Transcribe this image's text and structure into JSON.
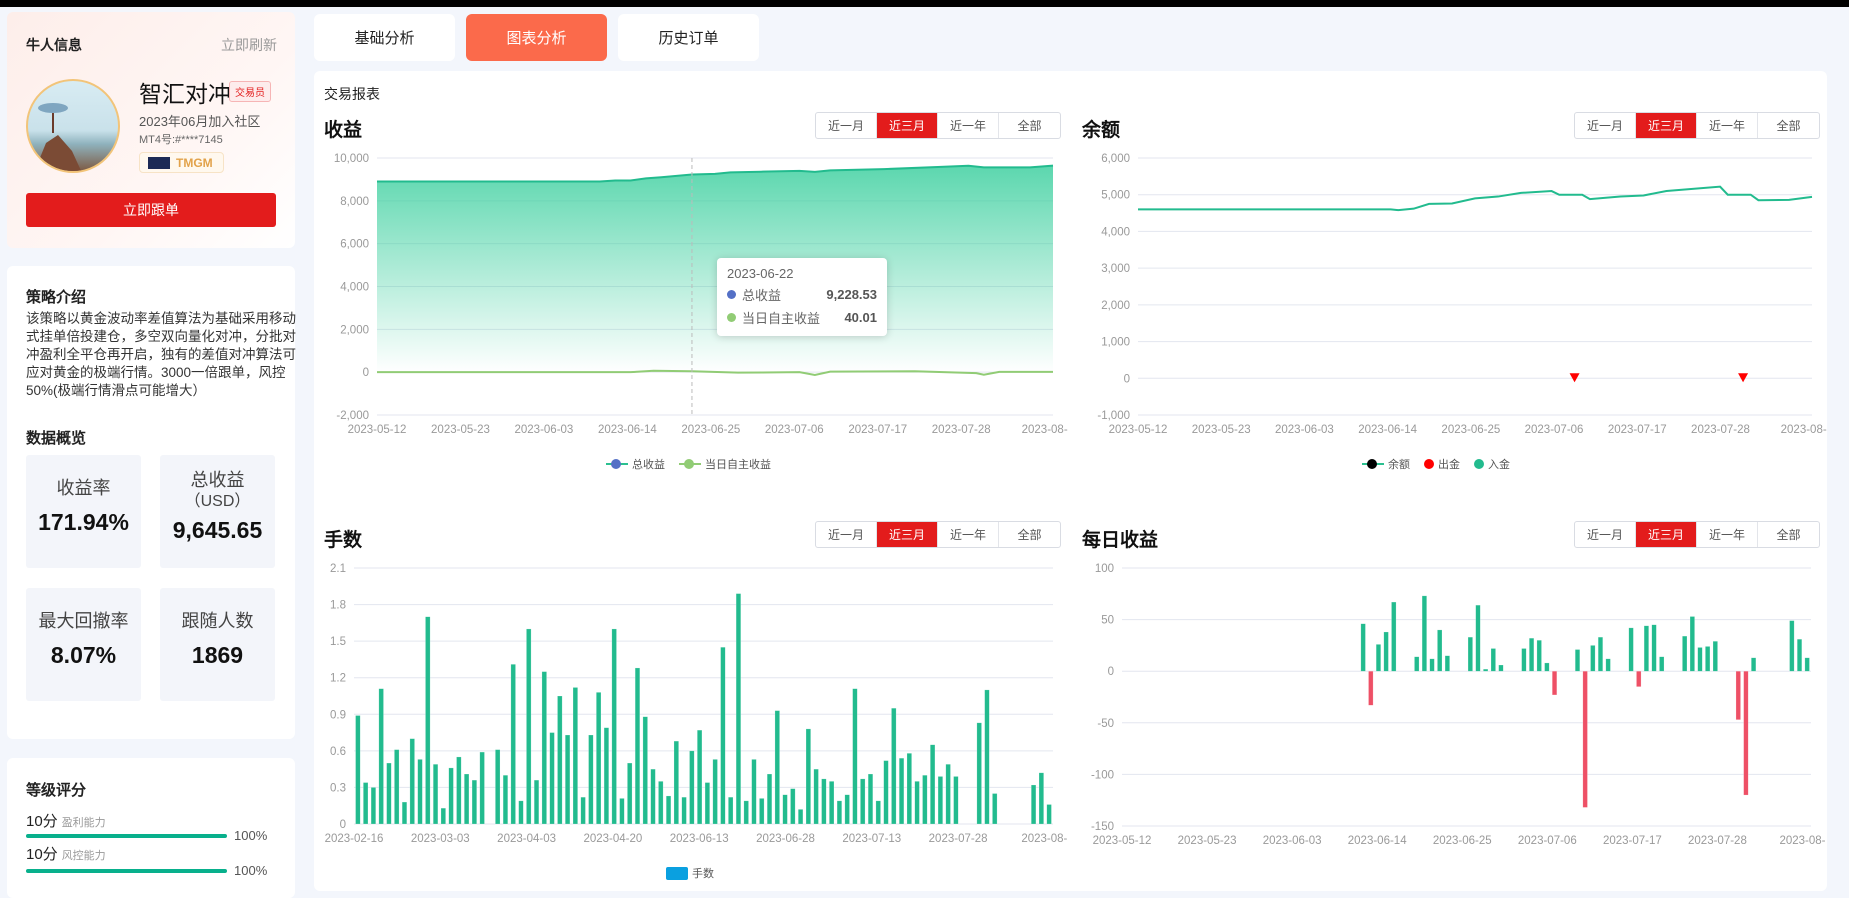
{
  "profile": {
    "section_title": "牛人信息",
    "refresh_label": "立即刷新",
    "name": "智汇对冲",
    "role_badge": "交易员",
    "joined": "2023年06月加入社区",
    "mt4": "MT4号:#****7145",
    "broker": "TMGM",
    "follow_button": "立即跟单"
  },
  "strategy": {
    "title": "策略介绍",
    "description": "该策略以黄金波动率差值算法为基础采用移动式挂单倍投建仓，多空双向量化对冲，分批对冲盈利全平仓再开启，独有的差值对冲算法可应对黄金的极端行情。3000一倍跟单，风控50%(极端行情滑点可能增大）"
  },
  "overview": {
    "title": "数据概览",
    "stats": [
      {
        "label": "收益率",
        "value": "171.94%"
      },
      {
        "label": "总收益",
        "label2": "（USD）",
        "value": "9,645.65"
      },
      {
        "label": "最大回撤率",
        "value": "8.07%"
      },
      {
        "label": "跟随人数",
        "value": "1869"
      }
    ]
  },
  "rating": {
    "title": "等级评分",
    "items": [
      {
        "score": "10分",
        "name": "盈利能力",
        "percent": "100%",
        "fraction": 1.0
      },
      {
        "score": "10分",
        "name": "风控能力",
        "percent": "100%",
        "fraction": 1.0
      }
    ]
  },
  "tabs": [
    {
      "label": "基础分析",
      "active": false
    },
    {
      "label": "图表分析",
      "active": true
    },
    {
      "label": "历史订单",
      "active": false
    }
  ],
  "report_title": "交易报表",
  "range_options": [
    "近一月",
    "近三月",
    "近一年",
    "全部"
  ],
  "range_selected": 1,
  "colors": {
    "accent": "#e31c1c",
    "tab_active": "#fb6a4b",
    "green": "#22bb8e",
    "red": "#ee5066",
    "blue": "#5470c6",
    "lightgreen": "#91cc75"
  },
  "tooltip": {
    "date": "2023-06-22",
    "rows": [
      {
        "label": "总收益",
        "value": "9,228.53"
      },
      {
        "label": "当日自主收益",
        "value": "40.01"
      }
    ]
  },
  "chart_data": [
    {
      "id": "profit",
      "type": "line",
      "title": "收益",
      "ylim": [
        -2000,
        10000
      ],
      "yticks": [
        "-2,000",
        "0",
        "2,000",
        "4,000",
        "6,000",
        "8,000",
        "10,000"
      ],
      "ytick_values": [
        -2000,
        0,
        2000,
        4000,
        6000,
        8000,
        10000
      ],
      "x_range": [
        "2023-05-12",
        "2023-08-08"
      ],
      "xticks": [
        "2023-05-12",
        "2023-05-23",
        "2023-06-03",
        "2023-06-14",
        "2023-06-25",
        "2023-07-06",
        "2023-07-17",
        "2023-07-28",
        "2023-08-"
      ],
      "legend": [
        "总收益",
        "当日自主收益"
      ],
      "series": [
        {
          "name": "总收益",
          "points": [
            [
              "2023-05-12",
              8900
            ],
            [
              "2023-06-10",
              8900
            ],
            [
              "2023-06-12",
              8950
            ],
            [
              "2023-06-14",
              8950
            ],
            [
              "2023-06-16",
              9050
            ],
            [
              "2023-06-18",
              9100
            ],
            [
              "2023-06-22",
              9228.53
            ],
            [
              "2023-06-25",
              9260
            ],
            [
              "2023-06-27",
              9330
            ],
            [
              "2023-07-01",
              9360
            ],
            [
              "2023-07-06",
              9400
            ],
            [
              "2023-07-08",
              9350
            ],
            [
              "2023-07-10",
              9420
            ],
            [
              "2023-07-17",
              9480
            ],
            [
              "2023-07-24",
              9580
            ],
            [
              "2023-07-28",
              9640
            ],
            [
              "2023-07-30",
              9560
            ],
            [
              "2023-08-05",
              9560
            ],
            [
              "2023-08-08",
              9645.65
            ]
          ]
        },
        {
          "name": "当日自主收益",
          "points": [
            [
              "2023-05-12",
              0
            ],
            [
              "2023-06-14",
              0
            ],
            [
              "2023-06-17",
              67
            ],
            [
              "2023-06-22",
              40.01
            ],
            [
              "2023-06-28",
              -23
            ],
            [
              "2023-07-06",
              0
            ],
            [
              "2023-07-08",
              -132
            ],
            [
              "2023-07-10",
              25
            ],
            [
              "2023-07-21",
              44
            ],
            [
              "2023-07-29",
              -47
            ],
            [
              "2023-07-30",
              -120
            ],
            [
              "2023-08-01",
              13
            ],
            [
              "2023-08-08",
              13
            ]
          ]
        }
      ]
    },
    {
      "id": "balance",
      "type": "line",
      "title": "余额",
      "ylim": [
        -1000,
        6000
      ],
      "yticks": [
        "-1,000",
        "0",
        "1,000",
        "2,000",
        "3,000",
        "4,000",
        "5,000",
        "6,000"
      ],
      "ytick_values": [
        -1000,
        0,
        1000,
        2000,
        3000,
        4000,
        5000,
        6000
      ],
      "x_range": [
        "2023-05-12",
        "2023-08-08"
      ],
      "xticks": [
        "2023-05-12",
        "2023-05-23",
        "2023-06-03",
        "2023-06-14",
        "2023-06-25",
        "2023-07-06",
        "2023-07-17",
        "2023-07-28",
        "2023-08-"
      ],
      "legend": [
        "余额",
        "出金",
        "入金"
      ],
      "series": [
        {
          "name": "余额",
          "points": [
            [
              "2023-05-12",
              4600
            ],
            [
              "2023-06-14",
              4600
            ],
            [
              "2023-06-15",
              4580
            ],
            [
              "2023-06-17",
              4620
            ],
            [
              "2023-06-19",
              4750
            ],
            [
              "2023-06-22",
              4760
            ],
            [
              "2023-06-25",
              4900
            ],
            [
              "2023-06-28",
              4950
            ],
            [
              "2023-07-01",
              5050
            ],
            [
              "2023-07-05",
              5100
            ],
            [
              "2023-07-06",
              5000
            ],
            [
              "2023-07-09",
              5000
            ],
            [
              "2023-07-10",
              4880
            ],
            [
              "2023-07-14",
              4950
            ],
            [
              "2023-07-17",
              4980
            ],
            [
              "2023-07-20",
              5100
            ],
            [
              "2023-07-27",
              5220
            ],
            [
              "2023-07-28",
              5000
            ],
            [
              "2023-07-31",
              5000
            ],
            [
              "2023-08-01",
              4850
            ],
            [
              "2023-08-05",
              4860
            ],
            [
              "2023-08-08",
              4940
            ]
          ]
        },
        {
          "name": "出金",
          "points": [
            [
              "2023-07-08",
              0
            ],
            [
              "2023-07-30",
              0
            ]
          ]
        },
        {
          "name": "入金",
          "points": []
        }
      ]
    },
    {
      "id": "lots",
      "type": "bar",
      "title": "手数",
      "ylim": [
        0,
        2.1
      ],
      "yticks": [
        "0",
        "0.3",
        "0.6",
        "0.9",
        "1.2",
        "1.5",
        "1.8",
        "2.1"
      ],
      "ytick_values": [
        0,
        0.3,
        0.6,
        0.9,
        1.2,
        1.5,
        1.8,
        2.1
      ],
      "xticks": [
        "2023-02-16",
        "2023-03-03",
        "2023-04-03",
        "2023-04-20",
        "2023-06-13",
        "2023-06-28",
        "2023-07-13",
        "2023-07-28",
        "2023-08-"
      ],
      "legend": [
        "手数"
      ],
      "values": [
        0.89,
        0.34,
        0.3,
        1.11,
        0.5,
        0.61,
        0.18,
        0.7,
        0.53,
        1.7,
        0.49,
        0.13,
        0.46,
        0.55,
        0.41,
        0.36,
        0.59,
        null,
        0.61,
        0.4,
        1.31,
        0.19,
        1.6,
        0.36,
        1.25,
        0.75,
        1.05,
        0.73,
        1.12,
        0.22,
        0.73,
        1.08,
        0.79,
        1.6,
        0.21,
        0.5,
        1.28,
        0.88,
        0.45,
        0.35,
        0.23,
        0.68,
        0.22,
        0.6,
        0.77,
        0.34,
        0.53,
        1.45,
        0.22,
        1.89,
        0.19,
        0.53,
        0.21,
        0.41,
        0.93,
        0.24,
        0.29,
        0.12,
        0.78,
        0.45,
        0.37,
        0.35,
        0.19,
        0.24,
        1.11,
        0.37,
        0.41,
        0.19,
        0.52,
        0.95,
        0.54,
        0.58,
        0.35,
        0.4,
        0.65,
        0.39,
        0.49,
        0.39,
        null,
        null,
        0.83,
        1.1,
        0.25,
        null,
        null,
        null,
        null,
        0.32,
        0.42,
        0.16
      ]
    },
    {
      "id": "daily",
      "type": "bar",
      "title": "每日收益",
      "ylim": [
        -150,
        100
      ],
      "yticks": [
        "-150",
        "-100",
        "-50",
        "0",
        "50",
        "100"
      ],
      "ytick_values": [
        -150,
        -100,
        -50,
        0,
        50,
        100
      ],
      "xticks": [
        "2023-05-12",
        "2023-05-23",
        "2023-06-03",
        "2023-06-14",
        "2023-06-25",
        "2023-07-06",
        "2023-07-17",
        "2023-07-28",
        "2023-08-"
      ],
      "values": [
        null,
        null,
        null,
        null,
        null,
        null,
        null,
        null,
        null,
        null,
        null,
        null,
        null,
        null,
        null,
        null,
        null,
        null,
        null,
        null,
        null,
        null,
        null,
        null,
        null,
        null,
        null,
        null,
        null,
        null,
        null,
        46,
        -33,
        26,
        38,
        67,
        null,
        null,
        14,
        73,
        12,
        40,
        15,
        null,
        null,
        33,
        64,
        2,
        22,
        6,
        null,
        null,
        22,
        32,
        30,
        8,
        -23,
        null,
        null,
        21,
        -132,
        25,
        33,
        12,
        null,
        null,
        42,
        -15,
        44,
        45,
        14,
        null,
        null,
        34,
        53,
        23,
        24,
        29,
        null,
        null,
        -47,
        -120,
        13,
        null,
        null,
        null,
        null,
        49,
        31,
        13
      ]
    }
  ]
}
